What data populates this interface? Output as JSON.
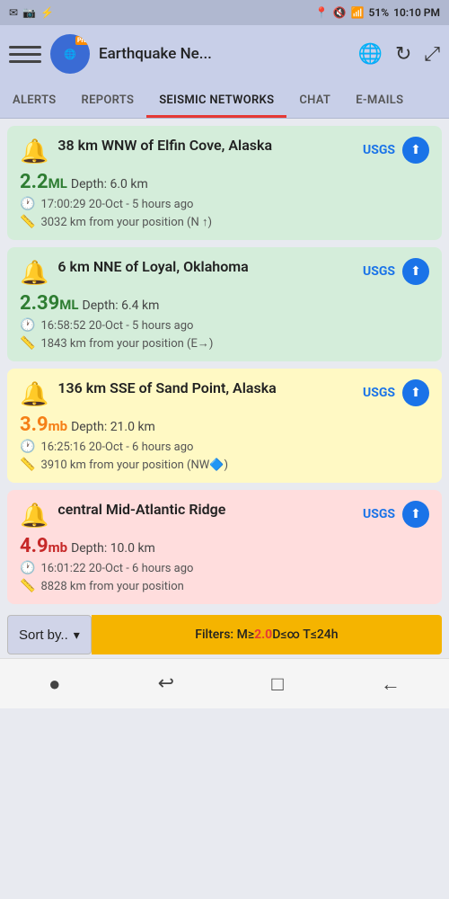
{
  "statusBar": {
    "leftIcons": [
      "✉",
      "📷",
      "⚡"
    ],
    "battery": "51%",
    "time": "10:10 PM",
    "signalIcons": [
      "📍",
      "🔇",
      "📶"
    ]
  },
  "appBar": {
    "title": "Earthquake Ne...",
    "proBadge": "Pro",
    "globalIconLabel": "globe",
    "refreshIconLabel": "refresh",
    "expandIconLabel": "expand"
  },
  "tabs": [
    {
      "id": "alerts",
      "label": "ALERTS",
      "active": false
    },
    {
      "id": "reports",
      "label": "REPORTS",
      "active": false
    },
    {
      "id": "seismic",
      "label": "SEISMIC NETWORKS",
      "active": true
    },
    {
      "id": "chat",
      "label": "CHAT",
      "active": false
    },
    {
      "id": "emails",
      "label": "E-MAILS",
      "active": false
    }
  ],
  "earthquakes": [
    {
      "id": "eq1",
      "location": "38 km WNW of Elfin Cove, Alaska",
      "magnitude": "2.2",
      "magType": "ML",
      "depth": "Depth: 6.0 km",
      "time": "17:00:29 20-Oct - 5 hours ago",
      "distance": "3032 km from your position (N ↑)",
      "source": "USGS",
      "cardColor": "green",
      "magColor": "green"
    },
    {
      "id": "eq2",
      "location": "6 km NNE of Loyal, Oklahoma",
      "magnitude": "2.39",
      "magType": "ML",
      "depth": "Depth: 6.4 km",
      "time": "16:58:52 20-Oct - 5 hours ago",
      "distance": "1843 km from your position (E→)",
      "source": "USGS",
      "cardColor": "green",
      "magColor": "green"
    },
    {
      "id": "eq3",
      "location": "136 km SSE of Sand Point, Alaska",
      "magnitude": "3.9",
      "magType": "mb",
      "depth": "Depth: 21.0 km",
      "time": "16:25:16 20-Oct - 6 hours ago",
      "distance": "3910 km from your position (NW🔷)",
      "source": "USGS",
      "cardColor": "yellow",
      "magColor": "yellow"
    },
    {
      "id": "eq4",
      "location": "central Mid-Atlantic Ridge",
      "magnitude": "4.9",
      "magType": "mb",
      "depth": "Depth: 10.0 km",
      "time": "16:01:22 20-Oct - 6 hours ago",
      "distance": "8828 km from your position",
      "source": "USGS",
      "cardColor": "pink",
      "magColor": "red"
    }
  ],
  "sortBar": {
    "label": "Sort by..",
    "chevron": "▾"
  },
  "filterBar": {
    "prefix": "Filters: M≥",
    "mValue": "2.0",
    "suffix": " D≤∞ T≤24h"
  },
  "bottomNav": {
    "icons": [
      "●",
      "⮐",
      "□",
      "←"
    ]
  }
}
